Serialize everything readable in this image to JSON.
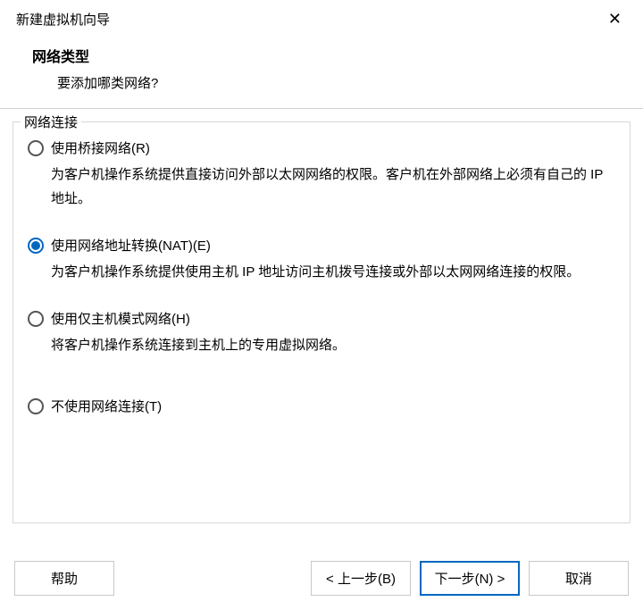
{
  "window": {
    "title": "新建虚拟机向导",
    "closeLabel": "✕"
  },
  "header": {
    "title": "网络类型",
    "subtitle": "要添加哪类网络?"
  },
  "fieldset": {
    "legend": "网络连接"
  },
  "options": [
    {
      "label": "使用桥接网络(R)",
      "desc": "为客户机操作系统提供直接访问外部以太网网络的权限。客户机在外部网络上必须有自己的 IP 地址。",
      "checked": false
    },
    {
      "label": "使用网络地址转换(NAT)(E)",
      "desc": "为客户机操作系统提供使用主机 IP 地址访问主机拨号连接或外部以太网网络连接的权限。",
      "checked": true
    },
    {
      "label": "使用仅主机模式网络(H)",
      "desc": "将客户机操作系统连接到主机上的专用虚拟网络。",
      "checked": false
    },
    {
      "label": "不使用网络连接(T)",
      "desc": "",
      "checked": false
    }
  ],
  "buttons": {
    "help": "帮助",
    "back": "< 上一步(B)",
    "next": "下一步(N) >",
    "cancel": "取消"
  }
}
